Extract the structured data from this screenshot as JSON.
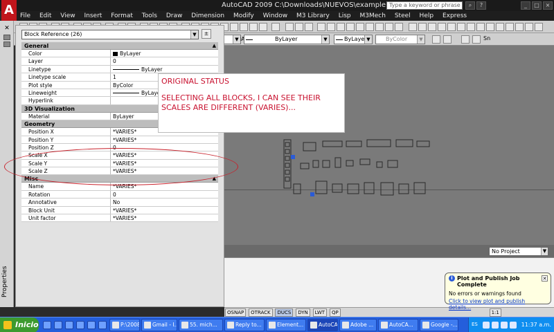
{
  "app": {
    "title": "AutoCAD 2009  C:\\Downloads\\NUEVOS\\example.dwg",
    "search_placeholder": "Type a keyword or phrase",
    "logo_letter": "A",
    "accent": "#c0151b"
  },
  "menu": [
    "File",
    "Edit",
    "View",
    "Insert",
    "Format",
    "Tools",
    "Draw",
    "Dimension",
    "Modify",
    "Window",
    "M3 Library",
    "Lisp",
    "M3Mech",
    "Steel",
    "Help",
    "Express"
  ],
  "toolbar": {
    "layer_combo": "ByLayer",
    "linetype_combo": "ByLayer",
    "color_combo": "ByColor",
    "dimstyle_label": "Sn",
    "snap_label": "SNAP"
  },
  "palette": {
    "selection": "Block Reference (26)",
    "vertical_title": "Properties",
    "sections": [
      {
        "name": "General",
        "rows": [
          {
            "key": "Color",
            "value": "ByLayer",
            "kind": "swatch"
          },
          {
            "key": "Layer",
            "value": "0"
          },
          {
            "key": "Linetype",
            "value": "ByLayer",
            "kind": "line"
          },
          {
            "key": "Linetype scale",
            "value": "1"
          },
          {
            "key": "Plot style",
            "value": "ByColor"
          },
          {
            "key": "Lineweight",
            "value": "ByLayer",
            "kind": "line"
          },
          {
            "key": "Hyperlink",
            "value": ""
          }
        ]
      },
      {
        "name": "3D Visualization",
        "rows": [
          {
            "key": "Material",
            "value": "ByLayer"
          }
        ]
      },
      {
        "name": "Geometry",
        "rows": [
          {
            "key": "Position X",
            "value": "*VARIES*"
          },
          {
            "key": "Position Y",
            "value": "*VARIES*"
          },
          {
            "key": "Position Z",
            "value": "0"
          },
          {
            "key": "Scale X",
            "value": "*VARIES*"
          },
          {
            "key": "Scale Y",
            "value": "*VARIES*"
          },
          {
            "key": "Scale Z",
            "value": "*VARIES*"
          }
        ]
      },
      {
        "name": "Misc",
        "rows": [
          {
            "key": "Name",
            "value": "*VARIES*"
          },
          {
            "key": "Rotation",
            "value": "0"
          },
          {
            "key": "Annotative",
            "value": "No"
          },
          {
            "key": "Block Unit",
            "value": "*VARIES*"
          },
          {
            "key": "Unit factor",
            "value": "*VARIES*"
          }
        ]
      }
    ]
  },
  "annotation": {
    "line1": "ORIGINAL STATUS",
    "line2": "SELECTING ALL BLOCKS, I CAN SEE THEIR SCALES ARE DIFFERENT (VARIES)...",
    "color": "#c8102e"
  },
  "project_combo": "No Project",
  "statusbar": [
    "OSNAP",
    "OTRACK",
    "DUCS",
    "DYN",
    "LWT",
    "QP"
  ],
  "zoom_label": "1:1",
  "balloon": {
    "title": "Plot and Publish Job Complete",
    "message": "No errors or warnings found",
    "link": "Click to view plot and publish details..."
  },
  "taskbar": {
    "start_label": "Inicio",
    "tasks": [
      "P:\\2008...",
      "Gmail - I...",
      "55. mich...",
      "Reply to...",
      "Element...",
      "AutoCA...",
      "Adobe ...",
      "AutoCA...",
      "Google -..."
    ],
    "lang": "ES",
    "clock": "11:37 a.m."
  }
}
